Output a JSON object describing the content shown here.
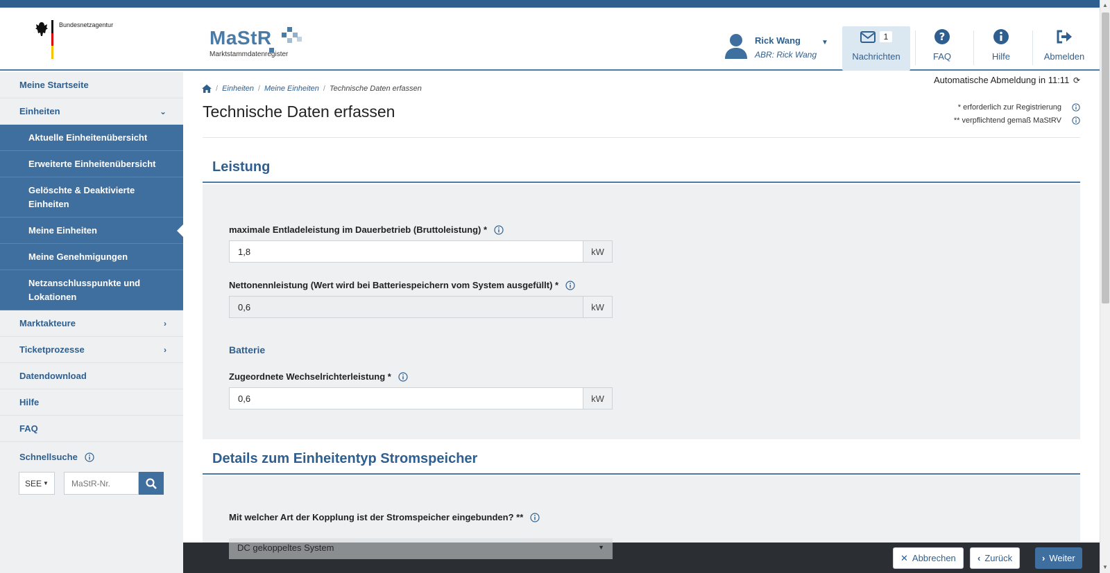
{
  "header": {
    "agency_name": "Bundesnetzagentur",
    "logo_text": "MaStR",
    "logo_subtitle": "Marktstammdatenregister",
    "user_name": "Rick Wang",
    "user_abr": "ABR: Rick Wang",
    "nav": {
      "messages_label": "Nachrichten",
      "messages_count": "1",
      "faq_label": "FAQ",
      "help_label": "Hilfe",
      "logout_label": "Abmelden"
    }
  },
  "sidebar": {
    "items": [
      {
        "label": "Meine Startseite"
      },
      {
        "label": "Einheiten"
      },
      {
        "label": "Aktuelle Einheitenübersicht"
      },
      {
        "label": "Erweiterte Einheitenübersicht"
      },
      {
        "label": "Gelöschte & Deaktivierte Einheiten"
      },
      {
        "label": "Meine Einheiten"
      },
      {
        "label": "Meine Genehmigungen"
      },
      {
        "label": "Netzanschlusspunkte und Lokationen"
      },
      {
        "label": "Marktakteure"
      },
      {
        "label": "Ticketprozesse"
      },
      {
        "label": "Datendownload"
      },
      {
        "label": "Hilfe"
      },
      {
        "label": "FAQ"
      }
    ],
    "quicksearch": {
      "label": "Schnellsuche",
      "type_value": "SEE",
      "placeholder": "MaStR-Nr."
    }
  },
  "main": {
    "breadcrumb": [
      "Einheiten",
      "Meine Einheiten",
      "Technische Daten erfassen"
    ],
    "auto_logout": "Automatische Abmeldung in 11:11",
    "required_note": "* erforderlich zur Registrierung",
    "mandatory_note": "** verpflichtend gemaß MaStRV",
    "page_title": "Technische Daten erfassen",
    "section_power": {
      "title": "Leistung",
      "field_gross": {
        "label": "maximale Entladeleistung im Dauerbetrieb (Bruttoleistung)",
        "marker": "*",
        "value": "1,8",
        "unit": "kW"
      },
      "field_net": {
        "label": "Nettonennleistung (Wert wird bei Batteriespeichern vom System ausgefüllt)",
        "marker": "*",
        "value": "0,6",
        "unit": "kW"
      },
      "battery_subhead": "Batterie",
      "field_inverter": {
        "label": "Zugeordnete Wechselrichterleistung",
        "marker": "*",
        "value": "0,6",
        "unit": "kW"
      }
    },
    "section_details": {
      "title": "Details zum Einheitentyp Stromspeicher",
      "coupling_label": "Mit welcher Art der Kopplung ist der Stromspeicher eingebunden?",
      "coupling_marker": "**",
      "coupling_value": "DC gekoppeltes System"
    }
  },
  "footer": {
    "cancel_label": "Abbrechen",
    "back_label": "Zurück",
    "next_label": "Weiter"
  },
  "colors": {
    "brand_blue": "#3f6f9e",
    "dark_blue": "#2f5f8f",
    "panel_gray": "#eef0f1"
  }
}
